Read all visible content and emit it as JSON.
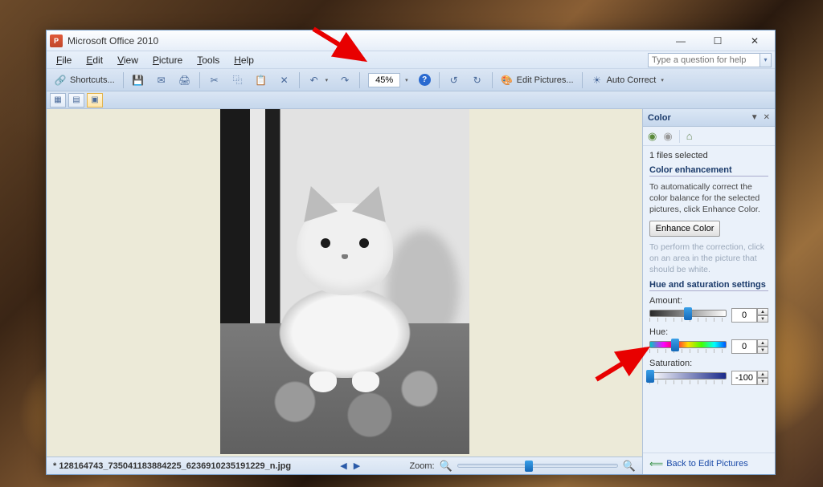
{
  "window": {
    "title": "Microsoft Office 2010"
  },
  "menubar": {
    "items": [
      {
        "key": "F",
        "rest": "ile"
      },
      {
        "key": "E",
        "rest": "dit"
      },
      {
        "key": "V",
        "rest": "iew"
      },
      {
        "key": "P",
        "rest": "icture"
      },
      {
        "key": "T",
        "rest": "ools"
      },
      {
        "key": "H",
        "rest": "elp"
      }
    ],
    "help_placeholder": "Type a question for help"
  },
  "toolbar": {
    "shortcuts_label": "Shortcuts...",
    "zoom_value": "45%",
    "edit_pictures_label": "Edit Pictures...",
    "auto_correct_label": "Auto Correct"
  },
  "statusbar": {
    "filename": "* 128164743_735041183884225_6236910235191229_n.jpg",
    "zoom_label": "Zoom:"
  },
  "side_panel": {
    "title": "Color",
    "files_selected": "1 files selected",
    "section_enhance_title": "Color enhancement",
    "enhance_desc": "To automatically correct the color balance for the selected pictures, click Enhance Color.",
    "enhance_button": "Enhance Color",
    "enhance_hint": "To perform the correction, click on an area in the picture that should be white.",
    "section_hue_title": "Hue and saturation settings",
    "amount": {
      "label": "Amount:",
      "value": "0",
      "thumb_pct": 50
    },
    "hue": {
      "label": "Hue:",
      "value": "0",
      "thumb_pct": 33
    },
    "saturation": {
      "label": "Saturation:",
      "value": "-100",
      "thumb_pct": 0
    },
    "back_link": "Back to Edit Pictures"
  }
}
